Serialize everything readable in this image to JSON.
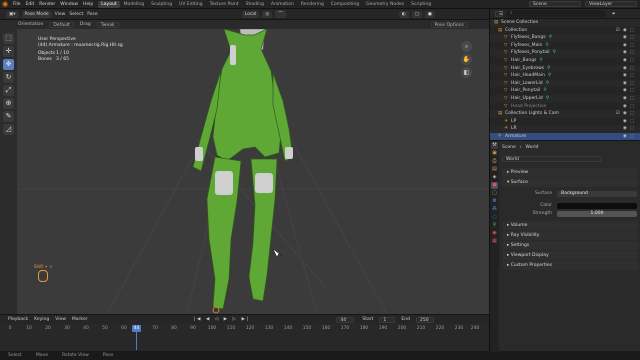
{
  "topbar": {
    "menus": [
      "File",
      "Edit",
      "Render",
      "Window",
      "Help"
    ],
    "workspaces": [
      "Layout",
      "Modeling",
      "Sculpting",
      "UV Editing",
      "Texture Paint",
      "Shading",
      "Animation",
      "Rendering",
      "Compositing",
      "Geometry Nodes",
      "Scripting"
    ],
    "active_workspace": "Layout",
    "scene": "Scene",
    "view_layer": "ViewLayer"
  },
  "viewport_header": {
    "mode": "Pose Mode",
    "menus": [
      "View",
      "Select",
      "Pose"
    ],
    "transform": "Local",
    "pose_options": "Pose Options"
  },
  "tool_settings": {
    "label": "Orientation",
    "orientation": "Default",
    "drag_label": "Drag",
    "drag": "Tweak"
  },
  "viewport": {
    "info_lines": [
      "User Perspective",
      "(44) Armature : moamecrig.Rig.Hit.sg"
    ],
    "objects_label": "Objects",
    "objects": "1 / 10",
    "bones_label": "Bones",
    "bones": "3 / 65",
    "hint": "Shift + ⇧",
    "background": "#3b3b3b",
    "model_color": "#5fa836"
  },
  "timeline": {
    "menus": [
      "Playback",
      "Keying",
      "View",
      "Marker"
    ],
    "current_frame": "44",
    "start_label": "Start",
    "start": "1",
    "end_label": "End",
    "end": "250",
    "ticks": [
      "0",
      "10",
      "20",
      "30",
      "40",
      "50",
      "60",
      "70",
      "80",
      "90",
      "100",
      "110",
      "120",
      "130",
      "140",
      "150",
      "160",
      "170",
      "180",
      "190",
      "200",
      "210",
      "220",
      "230",
      "240",
      "250"
    ]
  },
  "statusbar": {
    "items": [
      "Select",
      "Move",
      "Rotate View",
      "Pose"
    ]
  },
  "outliner": {
    "title": "Scene Collection",
    "rows": [
      {
        "name": "Scene Collection",
        "icon": "collection",
        "sel": false
      },
      {
        "name": "Collection",
        "icon": "collection",
        "sel": false
      },
      {
        "name": "Flyfexes_Bangs",
        "icon": "mesh",
        "sel": false
      },
      {
        "name": "Flyfexes_Main",
        "icon": "mesh",
        "sel": false
      },
      {
        "name": "Flyfexes_Ponytail",
        "icon": "mesh",
        "sel": false
      },
      {
        "name": "Hair_Bangs",
        "icon": "mesh",
        "sel": false
      },
      {
        "name": "Hair_Eyebrows",
        "icon": "mesh",
        "sel": false
      },
      {
        "name": "Hair_HeadMain",
        "icon": "mesh",
        "sel": false
      },
      {
        "name": "Hair_LowerLid",
        "icon": "mesh",
        "sel": false
      },
      {
        "name": "Hair_Ponytail",
        "icon": "mesh",
        "sel": false
      },
      {
        "name": "Hair_UpperLid",
        "icon": "mesh",
        "sel": false
      },
      {
        "name": "Head Projection",
        "icon": "mesh",
        "sel": false
      },
      {
        "name": "Collection Lights & Cam",
        "icon": "collection",
        "sel": false
      },
      {
        "name": "LP",
        "icon": "light",
        "sel": false
      },
      {
        "name": "LR",
        "icon": "light",
        "sel": false
      },
      {
        "name": "Armature",
        "icon": "armature",
        "sel": true
      }
    ]
  },
  "properties": {
    "breadcrumb": [
      "Scene",
      "World"
    ],
    "world_name": "World",
    "panels": [
      "Preview",
      "Surface",
      "Volume",
      "Ray Visibility",
      "Settings",
      "Viewport Display",
      "Custom Properties"
    ],
    "surface_label": "Surface",
    "surface_value": "Background",
    "color_label": "Color",
    "strength_label": "Strength",
    "strength_value": "1.000"
  }
}
